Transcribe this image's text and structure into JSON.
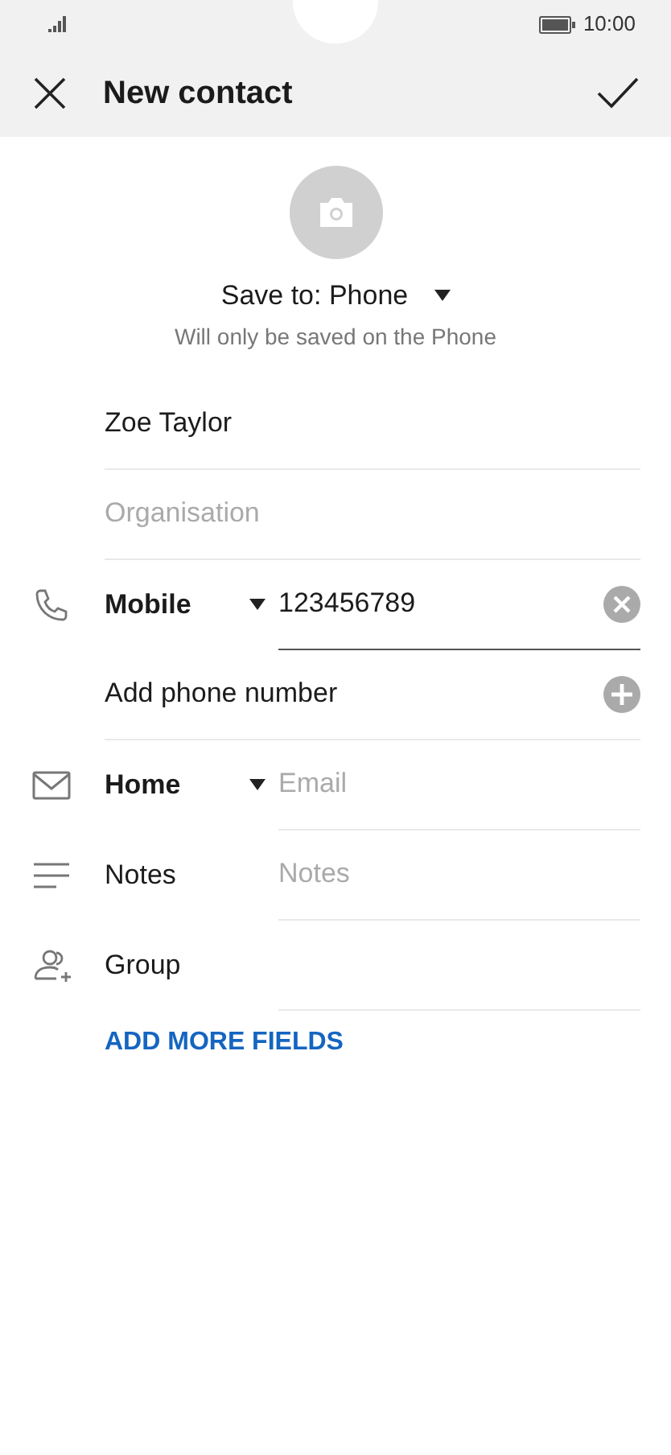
{
  "status_bar": {
    "time": "10:00"
  },
  "header": {
    "title": "New contact"
  },
  "save_to": {
    "label": "Save to: Phone",
    "note": "Will only be saved on the Phone"
  },
  "fields": [
    {
      "kind": "name",
      "value": "Zoe Taylor"
    },
    {
      "kind": "organisation",
      "placeholder": "Organisation"
    },
    {
      "kind": "phone",
      "label": "Mobile",
      "value": "123456789",
      "focused": true
    },
    {
      "kind": "add_phone",
      "label": "Add phone number"
    },
    {
      "kind": "email",
      "label": "Home",
      "placeholder": "Email",
      "focused": false
    },
    {
      "kind": "notes",
      "label": "Notes",
      "placeholder": "Notes"
    },
    {
      "kind": "group",
      "label": "Group"
    }
  ],
  "add_more_link": "ADD MORE FIELDS"
}
